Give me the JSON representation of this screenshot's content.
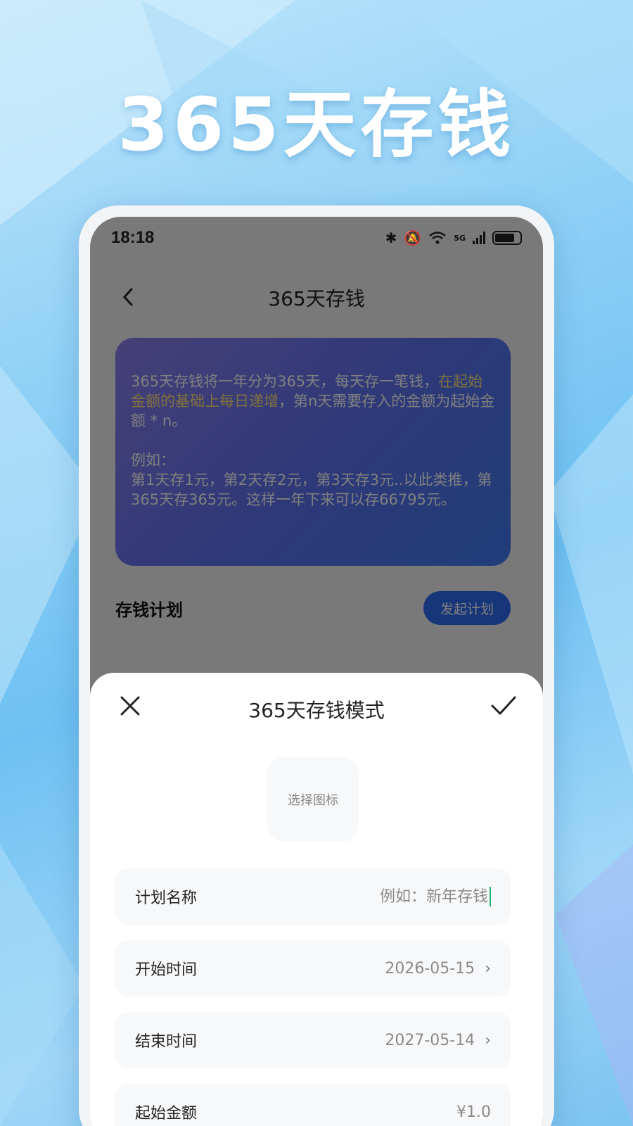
{
  "hero_title": "365天存钱",
  "status_bar": {
    "time": "18:18",
    "network_label": "5G"
  },
  "nav": {
    "title": "365天存钱"
  },
  "info_card": {
    "paragraph1_part1": "365天存钱将一年分为365天，每天存一笔钱，",
    "paragraph1_highlight": "在起始金额的基础上每日递增",
    "paragraph1_part2": "，第n天需要存入的金额为起始金额 * n。",
    "paragraph2_title": "例如：",
    "paragraph2_body": "第1天存1元，第2天存2元，第3天存3元..以此类推，第365天存365元。这样一年下来可以存66795元。"
  },
  "plan_section": {
    "title": "存钱计划",
    "start_button": "发起计划"
  },
  "sheet": {
    "title": "365天存钱模式",
    "icon_picker_label": "选择图标",
    "rows": [
      {
        "label": "计划名称",
        "placeholder": "例如：新年存钱"
      },
      {
        "label": "开始时间",
        "value": "2026-05-15"
      },
      {
        "label": "结束时间",
        "value": "2027-05-14"
      },
      {
        "label": "起始金额",
        "value": "¥1.0"
      }
    ]
  },
  "colors": {
    "card_gradient_start": "#8d7ff0",
    "card_gradient_end": "#3f7cf2",
    "highlight": "#ffe27a",
    "button_blue": "#2f6cf5"
  }
}
